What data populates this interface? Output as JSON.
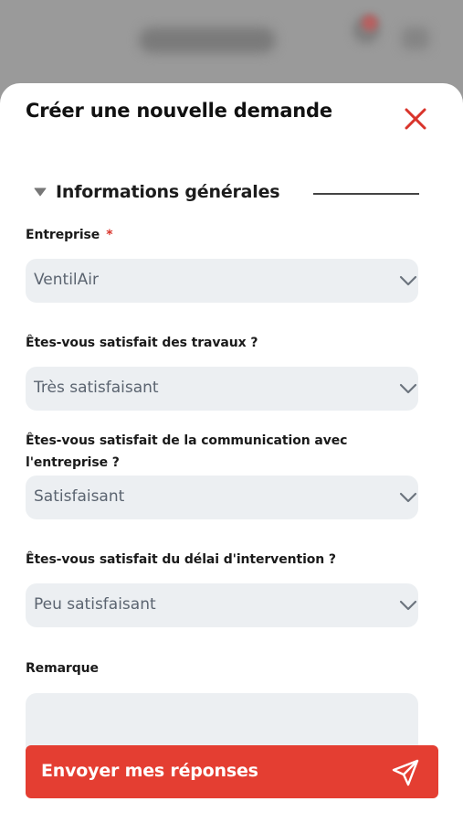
{
  "modal": {
    "title": "Créer une nouvelle demande"
  },
  "section": {
    "title": "Informations générales",
    "toggle_icon": "caret-down-icon"
  },
  "fields": [
    {
      "label": "Entreprise",
      "required_mark": "*",
      "value": "VentilAir"
    },
    {
      "label": "Êtes-vous satisfait des travaux ?",
      "value": "Très satisfaisant"
    },
    {
      "label_line1": "Êtes-vous satisfait de la communication avec",
      "label_line2": "l'entreprise ?",
      "value": "Satisfaisant"
    },
    {
      "label": "Êtes-vous satisfait du délai d'intervention ?",
      "value": "Peu satisfaisant"
    }
  ],
  "remark": {
    "label": "Remarque",
    "value": ""
  },
  "submit": {
    "label": "Envoyer mes réponses",
    "icon": "send-icon"
  },
  "colors": {
    "accent": "#e43e32",
    "close_icon": "#d9342b",
    "field_bg": "#eceff2"
  }
}
